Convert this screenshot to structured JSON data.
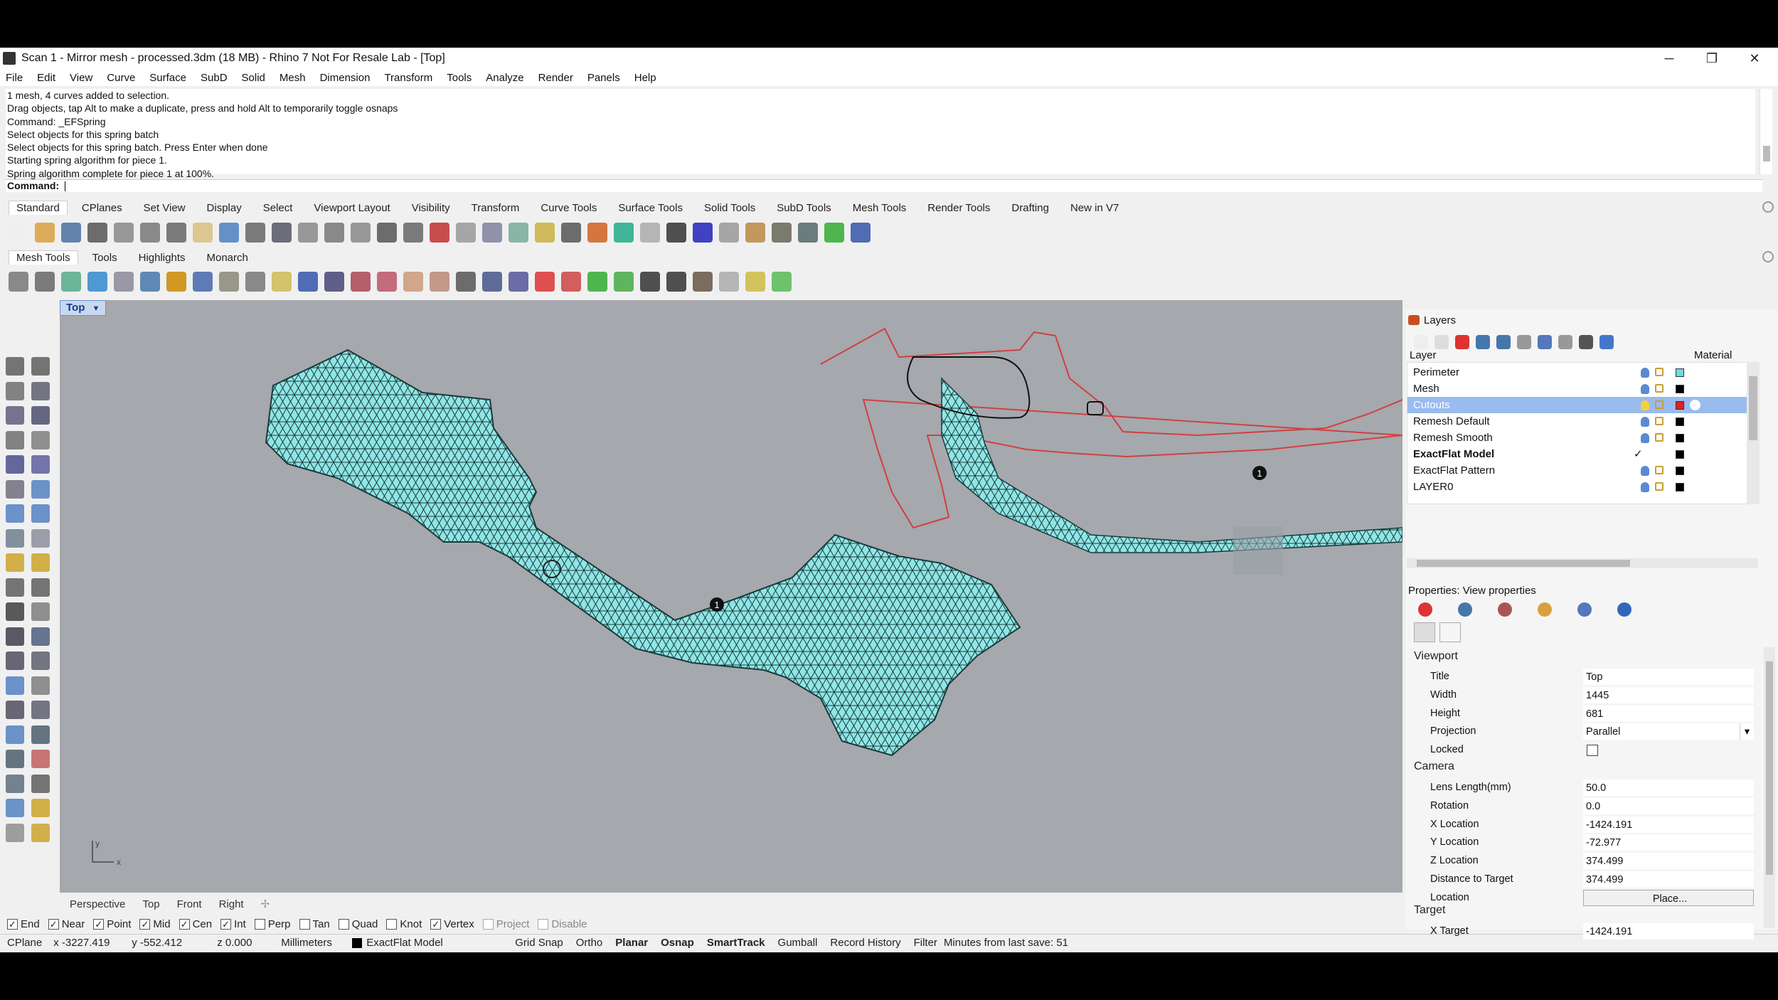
{
  "window": {
    "title": "Scan 1 - Mirror mesh - processed.3dm (18 MB) - Rhino 7 Not For Resale Lab - [Top]",
    "controls": [
      "─",
      "❐",
      "✕"
    ]
  },
  "menu": [
    "File",
    "Edit",
    "View",
    "Curve",
    "Surface",
    "SubD",
    "Solid",
    "Mesh",
    "Dimension",
    "Transform",
    "Tools",
    "Analyze",
    "Render",
    "Panels",
    "Help"
  ],
  "command_history": [
    "1 mesh, 4 curves added to selection.",
    "Drag objects, tap Alt to make a duplicate, press and hold Alt to temporarily toggle osnaps",
    "Command: _EFSpring",
    "Select objects for this spring batch",
    "Select objects for this spring batch. Press Enter when done",
    "Starting spring algorithm for piece 1.",
    "Spring algorithm complete for piece 1 at 100%."
  ],
  "command_prompt": "Command:",
  "toolbar_tabs": [
    "Standard",
    "CPlanes",
    "Set View",
    "Display",
    "Select",
    "Viewport Layout",
    "Visibility",
    "Transform",
    "Curve Tools",
    "Surface Tools",
    "Solid Tools",
    "SubD Tools",
    "Mesh Tools",
    "Render Tools",
    "Drafting",
    "New in V7"
  ],
  "toolbar2_tabs": [
    "Mesh Tools",
    "Tools",
    "Highlights",
    "Monarch"
  ],
  "viewport": {
    "title": "Top",
    "tabs": [
      "Perspective",
      "Top",
      "Front",
      "Right"
    ],
    "marker_labels": [
      "1",
      "1"
    ]
  },
  "layers_panel": {
    "title": "Layers",
    "col_layer": "Layer",
    "col_material": "Material",
    "rows": [
      {
        "name": "Perimeter",
        "color": "#66dddd",
        "selected": false,
        "bold": false
      },
      {
        "name": "Mesh",
        "color": "#000000",
        "selected": false,
        "bold": false
      },
      {
        "name": "Cutouts",
        "color": "#dd2222",
        "selected": true,
        "bold": false
      },
      {
        "name": "Remesh Default",
        "color": "#000000",
        "selected": false,
        "bold": false
      },
      {
        "name": "Remesh Smooth",
        "color": "#000000",
        "selected": false,
        "bold": false
      },
      {
        "name": "ExactFlat Model",
        "color": "#000000",
        "selected": false,
        "bold": true
      },
      {
        "name": "ExactFlat Pattern",
        "color": "#000000",
        "selected": false,
        "bold": false
      },
      {
        "name": "LAYER0",
        "color": "#000000",
        "selected": false,
        "bold": false
      }
    ],
    "current_mark": "✓"
  },
  "properties": {
    "title": "Properties: View properties",
    "viewport_section": "Viewport",
    "viewport_rows": [
      {
        "label": "Title",
        "value": "Top"
      },
      {
        "label": "Width",
        "value": "1445"
      },
      {
        "label": "Height",
        "value": "681"
      },
      {
        "label": "Projection",
        "value": "Parallel"
      },
      {
        "label": "Locked",
        "value": ""
      }
    ],
    "camera_section": "Camera",
    "camera_rows": [
      {
        "label": "Lens Length(mm)",
        "value": "50.0"
      },
      {
        "label": "Rotation",
        "value": "0.0"
      },
      {
        "label": "X Location",
        "value": "-1424.191"
      },
      {
        "label": "Y Location",
        "value": "-72.977"
      },
      {
        "label": "Z Location",
        "value": "374.499"
      },
      {
        "label": "Distance to Target",
        "value": "374.499"
      },
      {
        "label": "Location",
        "value": "Place..."
      }
    ],
    "target_section": "Target",
    "target_rows": [
      {
        "label": "X Target",
        "value": "-1424.191"
      }
    ]
  },
  "osnaps": [
    {
      "label": "End",
      "checked": true
    },
    {
      "label": "Near",
      "checked": true
    },
    {
      "label": "Point",
      "checked": true
    },
    {
      "label": "Mid",
      "checked": true
    },
    {
      "label": "Cen",
      "checked": true
    },
    {
      "label": "Int",
      "checked": true
    },
    {
      "label": "Perp",
      "checked": false
    },
    {
      "label": "Tan",
      "checked": false
    },
    {
      "label": "Quad",
      "checked": false
    },
    {
      "label": "Knot",
      "checked": false
    },
    {
      "label": "Vertex",
      "checked": true
    },
    {
      "label": "Project",
      "checked": false
    },
    {
      "label": "Disable",
      "checked": false
    }
  ],
  "status": {
    "cplane": "CPlane",
    "x": "x -3227.419",
    "y": "y -552.412",
    "z": "z 0.000",
    "units": "Millimeters",
    "layer": "ExactFlat Model",
    "buttons": [
      {
        "label": "Grid Snap",
        "on": false
      },
      {
        "label": "Ortho",
        "on": false
      },
      {
        "label": "Planar",
        "on": true
      },
      {
        "label": "Osnap",
        "on": true
      },
      {
        "label": "SmartTrack",
        "on": true
      },
      {
        "label": "Gumball",
        "on": false
      },
      {
        "label": "Record History",
        "on": false
      },
      {
        "label": "Filter",
        "on": false
      }
    ],
    "last_save": "Minutes from last save: 51"
  },
  "colors": {
    "mesh_fill": "#8fe6e6",
    "mesh_line": "#1a3a3a",
    "curve_red": "#d04040",
    "viewport_bg": "#a5a8ad",
    "selected_row": "#99bbee"
  }
}
